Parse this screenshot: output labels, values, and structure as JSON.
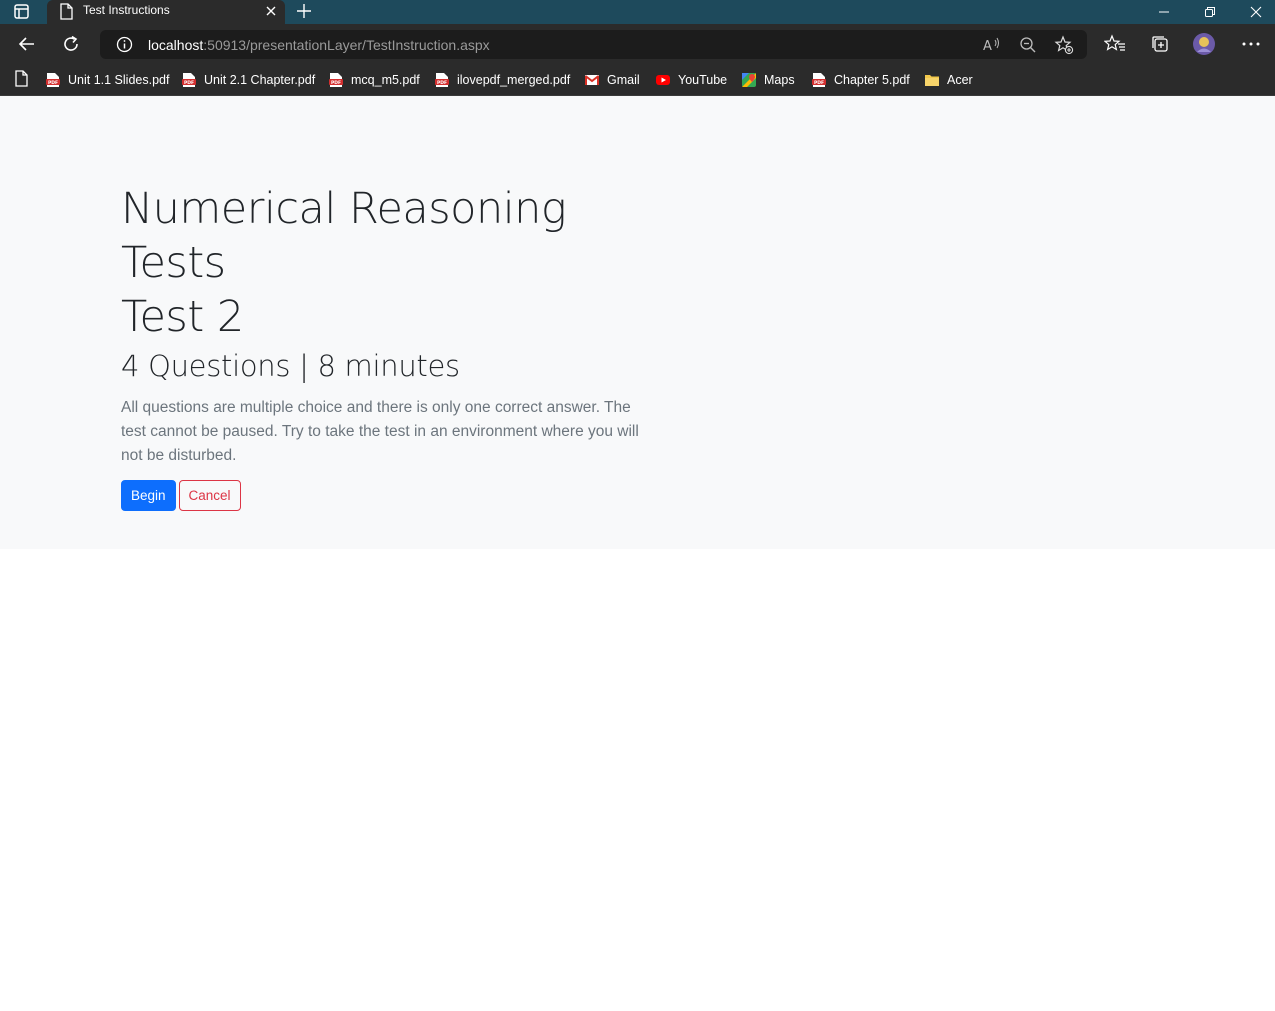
{
  "browser": {
    "tab_title": "Test Instructions",
    "url_host": "localhost",
    "url_rest": ":50913/presentationLayer/TestInstruction.aspx",
    "bookmarks": [
      {
        "label": "Unit 1.1 Slides.pdf",
        "icon": "pdf-icon"
      },
      {
        "label": "Unit 2.1 Chapter.pdf",
        "icon": "pdf-icon"
      },
      {
        "label": "mcq_m5.pdf",
        "icon": "pdf-icon"
      },
      {
        "label": "ilovepdf_merged.pdf",
        "icon": "pdf-icon"
      },
      {
        "label": "Gmail",
        "icon": "gmail-icon"
      },
      {
        "label": "YouTube",
        "icon": "youtube-icon"
      },
      {
        "label": "Maps",
        "icon": "maps-icon"
      },
      {
        "label": "Chapter 5.pdf",
        "icon": "pdf-icon"
      },
      {
        "label": "Acer",
        "icon": "folder-icon"
      }
    ]
  },
  "main": {
    "title_line1": "Numerical Reasoning Tests",
    "title_line2": "Test 2",
    "subtitle": "4 Questions | 8 minutes",
    "description": "All questions are multiple choice and there is only one correct answer. The test cannot be paused. Try to take the test in an environment where you will not be disturbed.",
    "begin_label": "Begin",
    "cancel_label": "Cancel"
  },
  "colors": {
    "titlebar": "#1e4a5c",
    "chrome": "#2b2b2b",
    "primary": "#0d6efd",
    "danger": "#dc3545",
    "jumbotron": "#f8f9fa"
  }
}
